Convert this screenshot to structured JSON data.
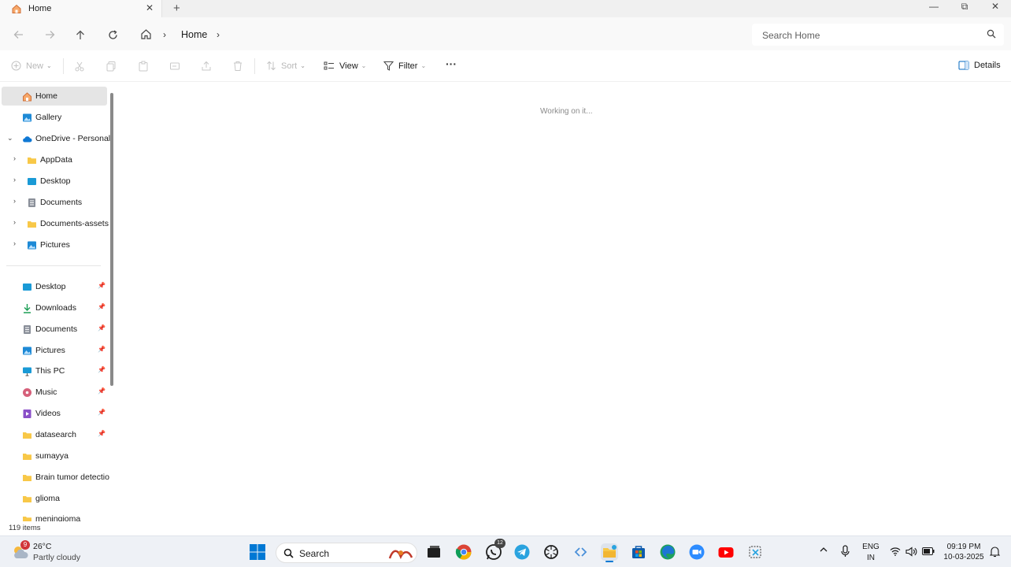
{
  "window": {
    "tab_title": "Home",
    "tab_close": "✕",
    "new_tab": "+",
    "minimize": "—",
    "maximize": "⧉",
    "close": "✕"
  },
  "address": {
    "breadcrumb_label": "Home",
    "search_placeholder": "Search Home"
  },
  "commands": {
    "new": "New",
    "sort": "Sort",
    "view": "View",
    "filter": "Filter",
    "more": "···",
    "details": "Details"
  },
  "sidebar": {
    "home": "Home",
    "gallery": "Gallery",
    "onedrive": "OneDrive - Personal",
    "onedrive_children": [
      "AppData",
      "Desktop",
      "Documents",
      "Documents-assets",
      "Pictures"
    ],
    "quick_access": [
      "Desktop",
      "Downloads",
      "Documents",
      "Pictures",
      "This PC",
      "Music",
      "Videos",
      "datasearch",
      "sumayya",
      "Brain tumor detectio",
      "glioma",
      "meningioma"
    ]
  },
  "main": {
    "loading_text": "Working on it..."
  },
  "status": {
    "item_count": "119 items"
  },
  "taskbar": {
    "weather_temp": "26°C",
    "weather_desc": "Partly cloudy",
    "weather_badge": "9",
    "search_label": "Search",
    "whatsapp_badge": "12",
    "language_top": "ENG",
    "language_bottom": "IN",
    "time": "09:19 PM",
    "date": "10-03-2025"
  },
  "colors": {
    "folder_yellow": "#f8c848",
    "onedrive_blue": "#0f78d4",
    "windows_blue": "#0078d4",
    "selection_gray": "#e5e5e5"
  }
}
